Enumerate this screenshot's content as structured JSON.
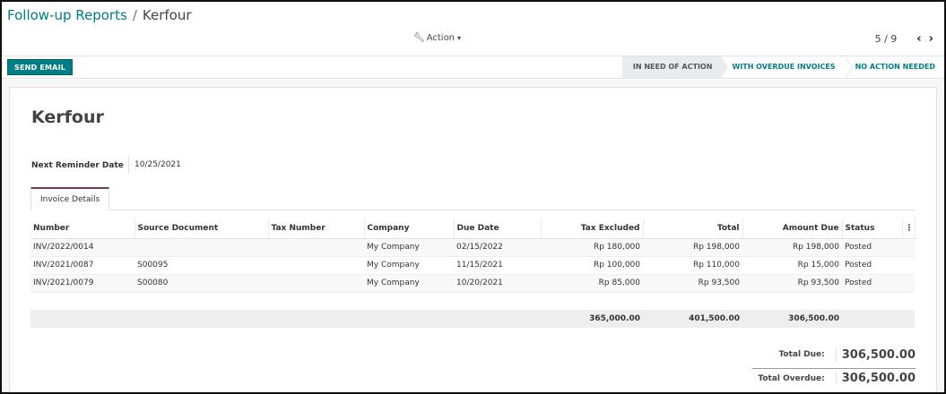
{
  "breadcrumb": {
    "parent": "Follow-up Reports",
    "separator": "/",
    "current": "Kerfour"
  },
  "action_menu": {
    "label": "Action"
  },
  "pager": {
    "value": "5 / 9",
    "prev": "‹",
    "next": "›"
  },
  "toolbar": {
    "send_email_label": "SEND EMAIL"
  },
  "stages": [
    {
      "label": "IN NEED OF ACTION",
      "active": true
    },
    {
      "label": "WITH OVERDUE INVOICES",
      "active": false
    },
    {
      "label": "NO ACTION NEEDED",
      "active": false
    }
  ],
  "form": {
    "partner_name": "Kerfour",
    "next_reminder_label": "Next Reminder Date",
    "next_reminder_value": "10/25/2021"
  },
  "tabs": [
    {
      "label": "Invoice Details"
    }
  ],
  "table": {
    "headers": [
      "Number",
      "Source Document",
      "Tax Number",
      "Company",
      "Due Date",
      "Tax Excluded",
      "Total",
      "Amount Due",
      "Status"
    ],
    "rows": [
      [
        "INV/2022/0014",
        "",
        "",
        "My Company",
        "02/15/2022",
        "Rp 180,000",
        "Rp 198,000",
        "Rp 198,000",
        "Posted"
      ],
      [
        "INV/2021/0087",
        "S00095",
        "",
        "My Company",
        "11/15/2021",
        "Rp 100,000",
        "Rp 110,000",
        "Rp 15,000",
        "Posted"
      ],
      [
        "INV/2021/0079",
        "S00080",
        "",
        "My Company",
        "10/20/2021",
        "Rp 85,000",
        "Rp 93,500",
        "Rp 93,500",
        "Posted"
      ]
    ],
    "footer": {
      "tax_excluded": "365,000.00",
      "total": "401,500.00",
      "amount_due": "306,500.00"
    }
  },
  "totals": {
    "due_label": "Total Due:",
    "due_value": "306,500.00",
    "overdue_label": "Total Overdue:",
    "overdue_value": "306,500.00"
  },
  "colors": {
    "accent": "#017e84",
    "tab_top": "#7c3a4a"
  }
}
